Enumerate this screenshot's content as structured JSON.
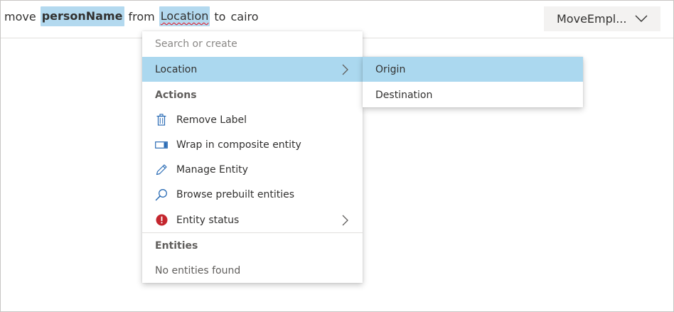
{
  "utterance": {
    "tokens": [
      {
        "text": "move",
        "entity": false
      },
      {
        "text": "personName",
        "entity": true
      },
      {
        "text": "from",
        "entity": false
      },
      {
        "text": "Location",
        "entity": true
      },
      {
        "text": "to",
        "entity": false
      },
      {
        "text": "cairo",
        "entity": false
      }
    ]
  },
  "intent_dropdown": {
    "value": "MoveEmpl...",
    "icon": "chevron-down-icon"
  },
  "context_menu": {
    "search_placeholder": "Search or create",
    "selected_entity": "Location",
    "actions_header": "Actions",
    "actions": [
      {
        "label": "Remove Label",
        "icon": "trash-icon"
      },
      {
        "label": "Wrap in composite entity",
        "icon": "composite-entity-icon"
      },
      {
        "label": "Manage Entity",
        "icon": "pencil-icon"
      },
      {
        "label": "Browse prebuilt entities",
        "icon": "search-icon"
      },
      {
        "label": "Entity status",
        "icon": "error-status-icon"
      }
    ],
    "entities_header": "Entities",
    "entities_empty": "No entities found"
  },
  "submenu": {
    "items": [
      {
        "label": "Origin",
        "active": true
      },
      {
        "label": "Destination",
        "active": false
      }
    ]
  },
  "colors": {
    "entity_highlight": "#b3d9ef",
    "active_row": "#abd8ef",
    "accent_blue": "#2b6cb5",
    "error_red": "#c4262e",
    "dropdown_bg": "#f3f2f1"
  }
}
